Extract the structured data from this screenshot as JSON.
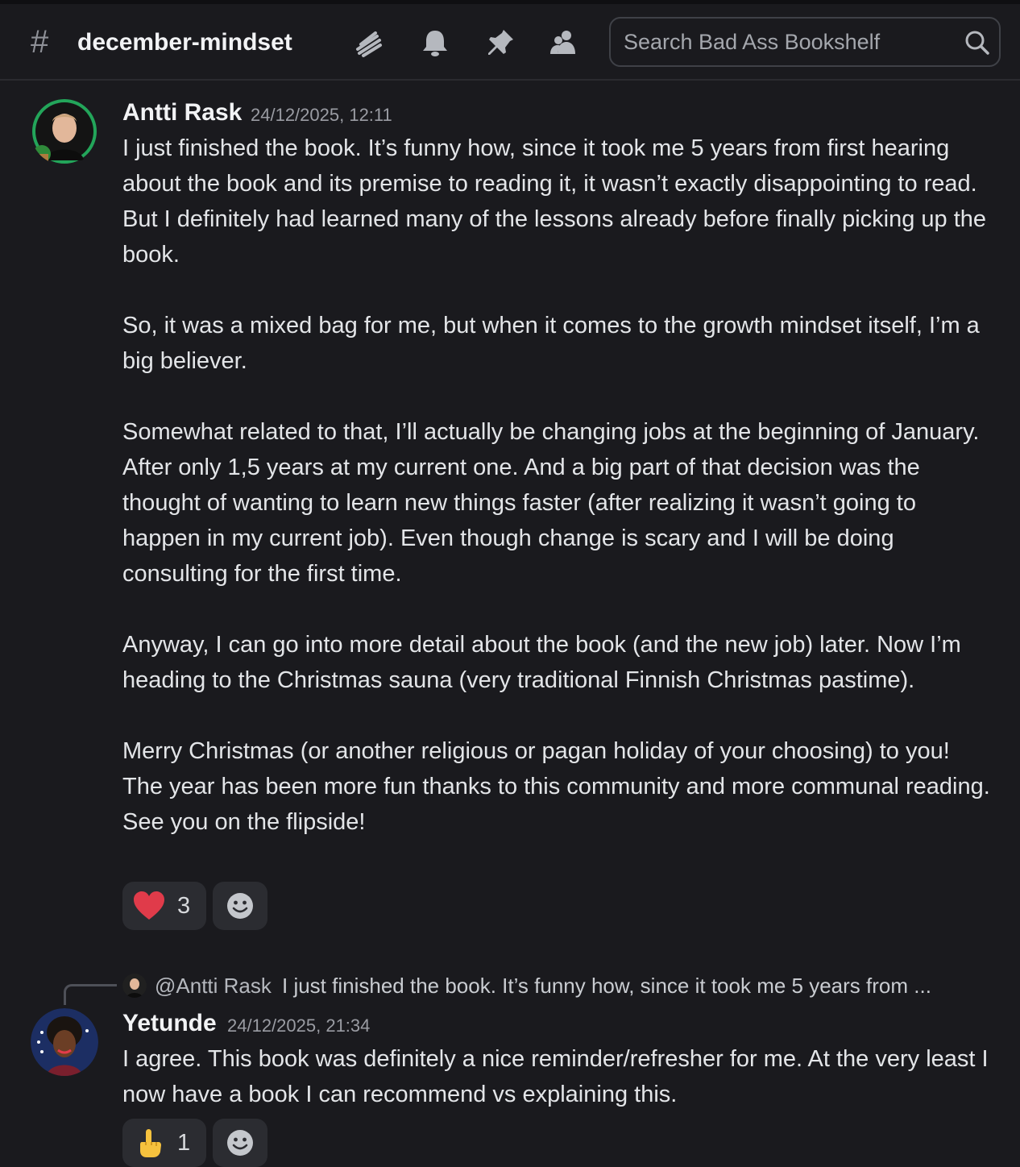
{
  "header": {
    "channel_name": "december-mindset",
    "search_placeholder": "Search Bad Ass Bookshelf",
    "icons": [
      "threads-icon",
      "bell-icon",
      "pin-icon",
      "members-icon"
    ]
  },
  "messages": [
    {
      "author": "Antti Rask",
      "timestamp": "24/12/2025, 12:11",
      "paragraphs": [
        "I just finished the book. It’s funny how, since it took me 5 years from first hearing about the book and its premise to reading it, it wasn’t exactly disappointing to read. But I definitely had learned many of the lessons already before finally picking up the book.",
        "So, it was a mixed bag for me, but when it comes to the growth mindset itself, I’m a big believer.",
        "Somewhat related to that, I’ll actually be changing jobs at the beginning of January. After only 1,5 years at my current one. And a big part of that decision was the thought of wanting to learn new things faster (after realizing it wasn’t going to happen in my current job). Even though change is scary and I will be doing consulting for the first time.",
        "Anyway, I can go into more detail about the book (and the new job) later. Now I’m heading to the Christmas sauna (very traditional Finnish Christmas pastime).",
        "Merry Christmas (or another religious or pagan holiday of your choosing) to you! The year has been more fun thanks to this community and more communal reading. See you on the flipside!"
      ],
      "reaction": {
        "emoji": "heart-emoji",
        "count": "3"
      }
    },
    {
      "reply_to": {
        "mention": "@Antti Rask",
        "preview": "I just finished the book. It’s funny how, since it took me 5 years from ..."
      },
      "author": "Yetunde",
      "timestamp": "24/12/2025, 21:34",
      "paragraphs": [
        "I agree. This book was definitely a nice reminder/refresher for me. At the very least I now have a book I can recommend vs explaining this."
      ],
      "reaction": {
        "emoji": "index-pointing-up-emoji",
        "count": "1"
      }
    }
  ],
  "colors": {
    "background": "#1a1a1e",
    "reaction_bg": "#2b2c31",
    "heart": "#e03b4a",
    "avatar_ring": "#23a55a"
  }
}
